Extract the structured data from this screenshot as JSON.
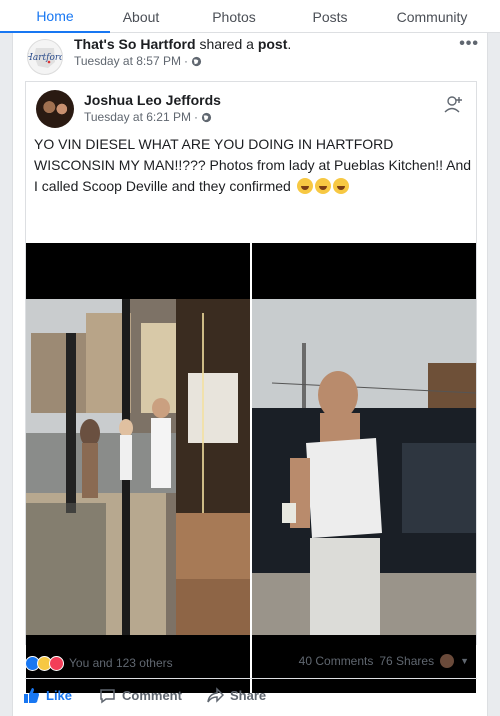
{
  "tabs": [
    "Home",
    "About",
    "Photos",
    "Posts",
    "Community"
  ],
  "post": {
    "page_name": "That's So Hartford",
    "action_text": " shared a ",
    "object_text": "post",
    "period": ".",
    "timestamp": "Tuesday at 8:57 PM",
    "more_label": "•••"
  },
  "shared_post": {
    "author": "Joshua Leo Jeffords",
    "timestamp": "Tuesday at 6:21 PM",
    "text": "YO VIN DIESEL WHAT ARE YOU DOING IN HARTFORD WISCONSIN MY MAN!!??? Photos from lady at Pueblas Kitchen!! And I called Scoop Deville and they confirmed"
  },
  "engagement": {
    "reactions_text": "You and 123 others",
    "comments": "40 Comments",
    "shares": "76 Shares"
  },
  "actions": {
    "like": "Like",
    "comment": "Comment",
    "share": "Share"
  },
  "colors": {
    "accent": "#1877f2",
    "muted": "#606770"
  }
}
